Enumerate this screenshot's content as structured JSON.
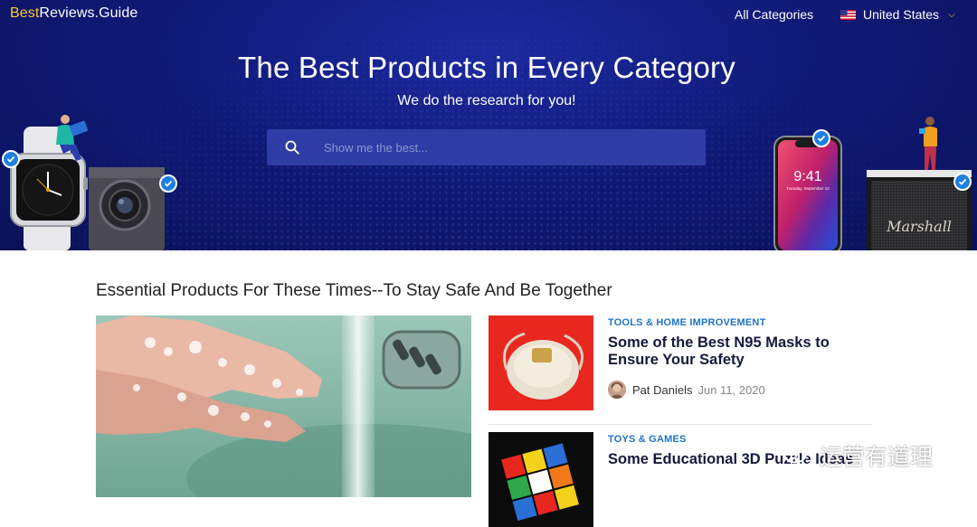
{
  "header": {
    "logo_prefix": "Best",
    "logo_suffix": "Reviews.Guide",
    "nav_categories": "All Categories",
    "country": "United States"
  },
  "hero": {
    "title": "The Best Products in Every Category",
    "subtitle": "We do the research for you!",
    "search_placeholder": "Show me the best..."
  },
  "hero_products": {
    "phone_time": "9:41",
    "phone_date": "Tuesday, September 12",
    "speaker_brand": "Marshall"
  },
  "section": {
    "title": "Essential Products For These Times--To Stay Safe And Be Together"
  },
  "articles": [
    {
      "category": "TOOLS & HOME IMPROVEMENT",
      "title": "Some of the Best N95 Masks to Ensure Your Safety",
      "author": "Pat Daniels",
      "date": "Jun 11, 2020"
    },
    {
      "category": "TOYS & GAMES",
      "title": "Some Educational 3D Puzzle Ideas"
    }
  ],
  "watermark": "运营有道理",
  "colors": {
    "hero_bg": "#101a78",
    "search_bg": "#2f3ca5",
    "logo_accent": "#ffc72c",
    "category_blue": "#1e73c8",
    "check_blue": "#1e7fe0"
  }
}
